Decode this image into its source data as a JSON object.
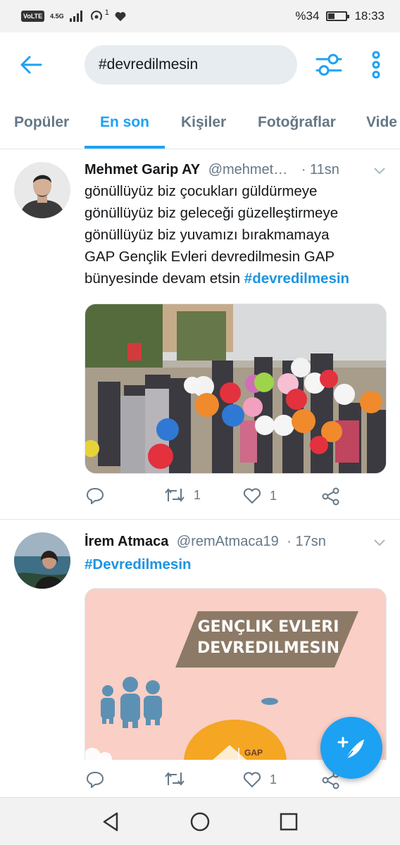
{
  "status_bar": {
    "volte": "VoLTE",
    "network": "4.5G",
    "notif_count": "1",
    "battery_text": "%34",
    "battery_level": 0.34,
    "time": "18:33"
  },
  "header": {
    "search_value": "#devredilmesin",
    "accent_color": "#1da1f2"
  },
  "tabs": [
    {
      "label": "Popüler",
      "active": false
    },
    {
      "label": "En son",
      "active": true
    },
    {
      "label": "Kişiler",
      "active": false
    },
    {
      "label": "Fotoğraflar",
      "active": false
    },
    {
      "label": "Vide",
      "active": false
    }
  ],
  "tweets": [
    {
      "name": "Mehmet Garip AY",
      "handle": "@mehmet…",
      "time": "· 11sn",
      "text_lines": [
        "gönüllüyüz biz çocukları güldürmeye",
        "gönüllüyüz biz geleceği güzelleştirmeye",
        "gönüllüyüz biz yuvamızı bırakmamaya",
        "GAP Gençlik Evleri devredilmesin GAP",
        "bünyesinde devam etsin"
      ],
      "hashtag": "#devredilmesin",
      "retweets": "1",
      "likes": "1"
    },
    {
      "name": "İrem Atmaca",
      "handle": "@remAtmaca19",
      "time": "· 17sn",
      "hashtag": "#Devredilmesin",
      "media_title_line1": "GENÇLIK EVLERI",
      "media_title_line2": "DEVREDILMESIN",
      "media_logo_text": "GAP",
      "retweets": "",
      "likes": "1"
    }
  ]
}
